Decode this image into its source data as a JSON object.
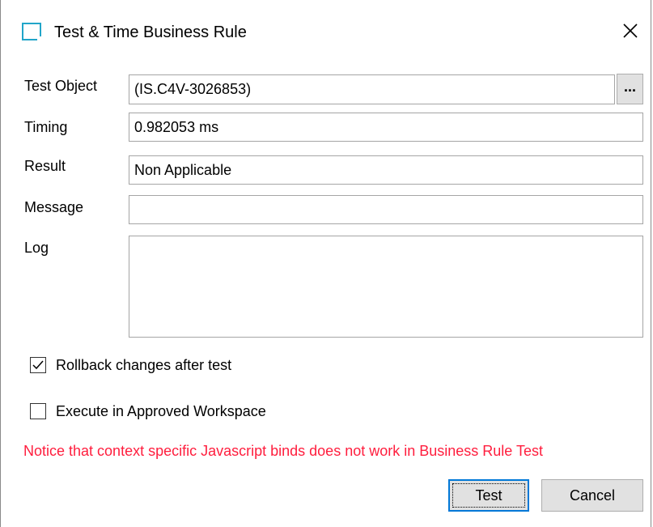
{
  "window": {
    "title": "Test & Time Business Rule",
    "icon": "app-icon",
    "close_icon": "close-icon"
  },
  "form": {
    "test_object": {
      "label": "Test Object",
      "value": "(IS.C4V-3026853)",
      "browse_label": "..."
    },
    "timing": {
      "label": "Timing",
      "value": "0.982053 ms"
    },
    "result": {
      "label": "Result",
      "value": "Non Applicable"
    },
    "message": {
      "label": "Message",
      "value": ""
    },
    "log": {
      "label": "Log",
      "value": ""
    }
  },
  "options": {
    "rollback": {
      "label": "Rollback changes after test",
      "checked": true
    },
    "approved_workspace": {
      "label": "Execute in Approved Workspace",
      "checked": false
    }
  },
  "notice": {
    "text": "Notice that context specific Javascript binds does not work in Business Rule Test",
    "color": "#ff1d3d"
  },
  "buttons": {
    "test_label": "Test",
    "cancel_label": "Cancel"
  },
  "colors": {
    "accent": "#0078d7",
    "icon": "#21a5c9"
  }
}
